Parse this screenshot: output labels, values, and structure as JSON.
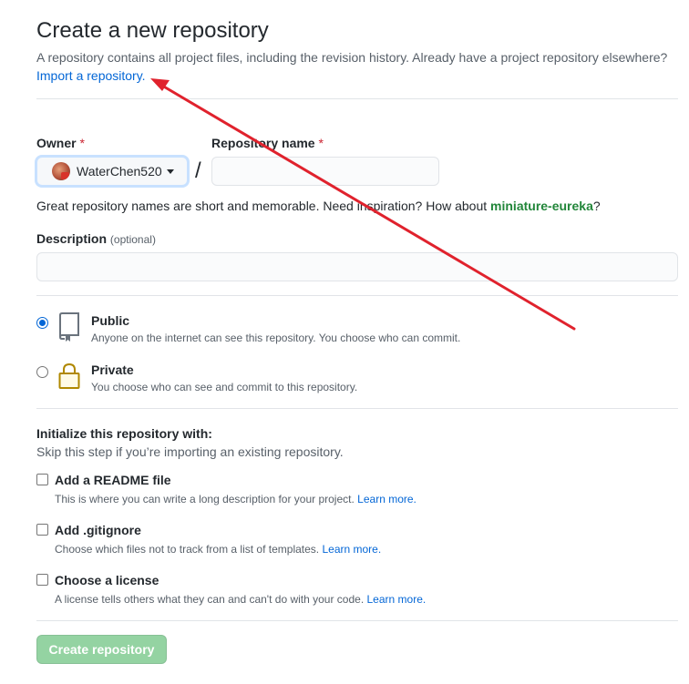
{
  "header": {
    "title": "Create a new repository",
    "subtitle": "A repository contains all project files, including the revision history. Already have a project repository elsewhere?",
    "import_link": "Import a repository."
  },
  "owner": {
    "label": "Owner",
    "required_mark": "*",
    "selected": "WaterChen520"
  },
  "repo_name": {
    "label": "Repository name",
    "required_mark": "*",
    "value": "",
    "separator": "/"
  },
  "hint": {
    "text_before": "Great repository names are short and memorable. Need inspiration? How about ",
    "suggestion": "miniature-eureka",
    "text_after": "?"
  },
  "description": {
    "label": "Description",
    "optional": "(optional)",
    "value": ""
  },
  "visibility": {
    "public": {
      "title": "Public",
      "desc": "Anyone on the internet can see this repository. You choose who can commit.",
      "selected": true
    },
    "private": {
      "title": "Private",
      "desc": "You choose who can see and commit to this repository.",
      "selected": false
    }
  },
  "init": {
    "title": "Initialize this repository with:",
    "subtitle": "Skip this step if you’re importing an existing repository.",
    "options": [
      {
        "title": "Add a README file",
        "desc": "This is where you can write a long description for your project.",
        "link": "Learn more."
      },
      {
        "title": "Add .gitignore",
        "desc": "Choose which files not to track from a list of templates.",
        "link": "Learn more."
      },
      {
        "title": "Choose a license",
        "desc": "A license tells others what they can and can't do with your code.",
        "link": "Learn more."
      }
    ]
  },
  "create_button": "Create repository",
  "annotation": {
    "arrow_color": "#e0222d"
  },
  "colors": {
    "link": "#0366d6",
    "suggestion": "#22863a",
    "required": "#cb2431",
    "button_disabled": "#94d3a2"
  }
}
